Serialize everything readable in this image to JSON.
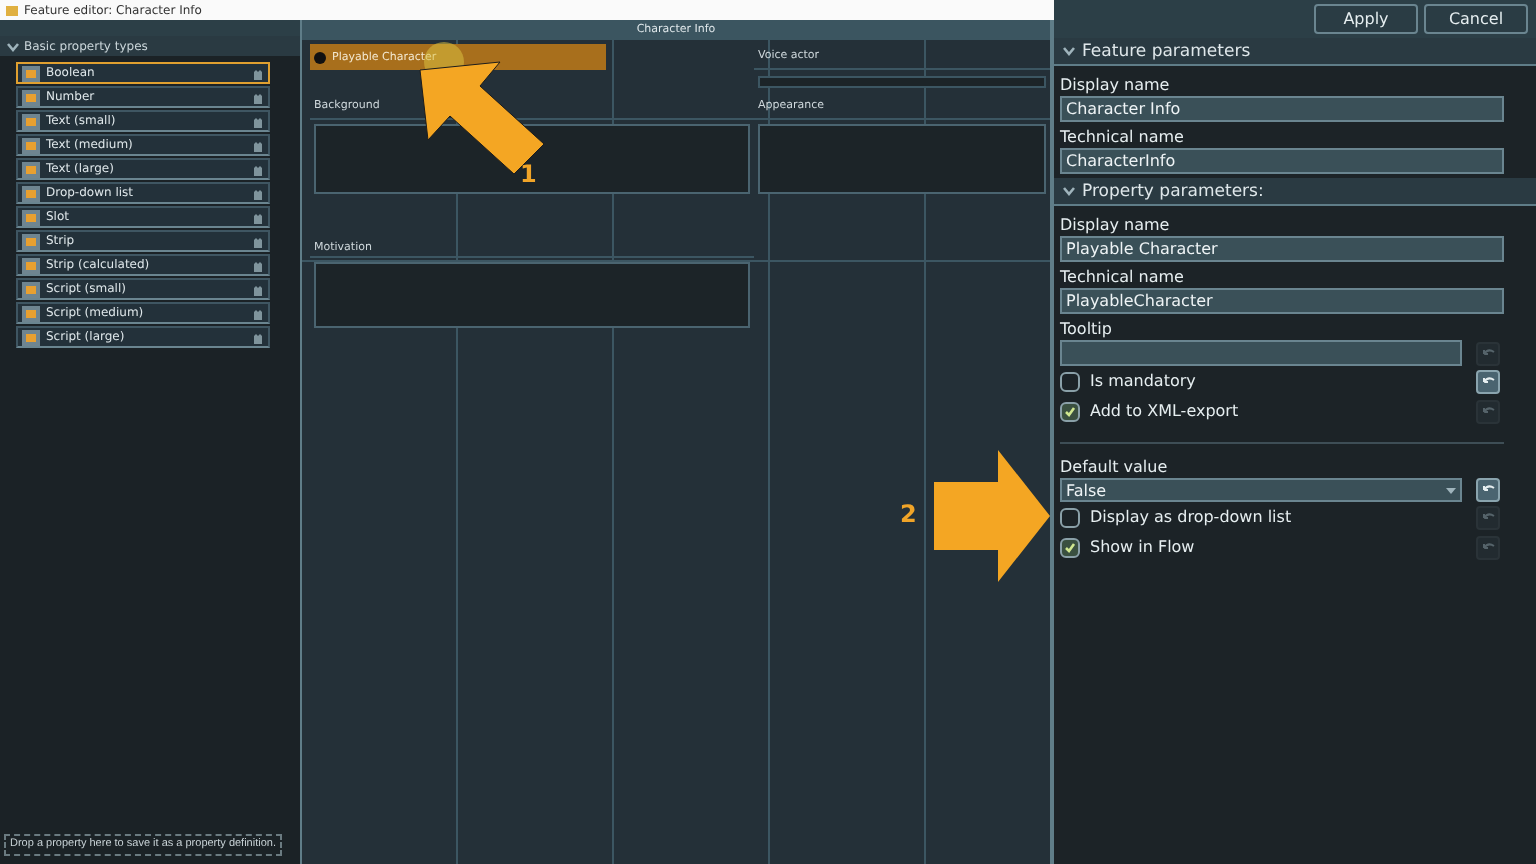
{
  "window": {
    "title": "Feature editor: Character Info"
  },
  "toolbar": {
    "buttons": [
      "Apply",
      "Cancel"
    ]
  },
  "palette": {
    "header": "Basic property types",
    "expanded": true,
    "items": [
      {
        "label": "Boolean",
        "selected": true
      },
      {
        "label": "Number",
        "selected": false
      },
      {
        "label": "Text (small)",
        "selected": false
      },
      {
        "label": "Text (medium)",
        "selected": false
      },
      {
        "label": "Text (large)",
        "selected": false
      },
      {
        "label": "Drop-down list",
        "selected": false
      },
      {
        "label": "Slot",
        "selected": false
      },
      {
        "label": "Strip",
        "selected": false
      },
      {
        "label": "Strip (calculated)",
        "selected": false
      },
      {
        "label": "Script (small)",
        "selected": false
      },
      {
        "label": "Script (medium)",
        "selected": false
      },
      {
        "label": "Script (large)",
        "selected": false
      }
    ],
    "hint": "Drop a property here to save it as a property definition."
  },
  "canvas": {
    "title": "Character Info",
    "fields": [
      {
        "kind": "checkbox",
        "label": "Playable Character",
        "selected": true
      },
      {
        "kind": "line",
        "label": "Voice actor"
      },
      {
        "kind": "area",
        "label": "Background"
      },
      {
        "kind": "area",
        "label": "Appearance"
      },
      {
        "kind": "area",
        "label": "Motivation"
      }
    ]
  },
  "feature_parameters": {
    "header": "Feature parameters",
    "expanded": true,
    "fields": [
      {
        "label": "Display name",
        "value": "Character Info"
      },
      {
        "label": "Technical name",
        "value": "CharacterInfo"
      }
    ]
  },
  "property_parameters": {
    "header": "Property parameters:",
    "expanded": true,
    "fields": [
      {
        "label": "Display name",
        "value": "Playable Character"
      },
      {
        "label": "Technical name",
        "value": "PlayableCharacter"
      }
    ],
    "tooltip": {
      "label": "Tooltip",
      "reset_enabled": false
    },
    "options": [
      {
        "label": "Is mandatory",
        "checked": false,
        "reset_enabled": true
      },
      {
        "label": "Add to XML-export",
        "checked": true,
        "reset_enabled": false
      }
    ],
    "default_value": {
      "label": "Default value",
      "value": "False",
      "reset_enabled": true
    },
    "more_options": [
      {
        "label": "Display as drop-down list",
        "checked": false,
        "reset_enabled": false
      },
      {
        "label": "Show in Flow",
        "checked": true,
        "reset_enabled": false
      }
    ]
  },
  "annotations": [
    {
      "number": "1"
    },
    {
      "number": "2"
    }
  ]
}
